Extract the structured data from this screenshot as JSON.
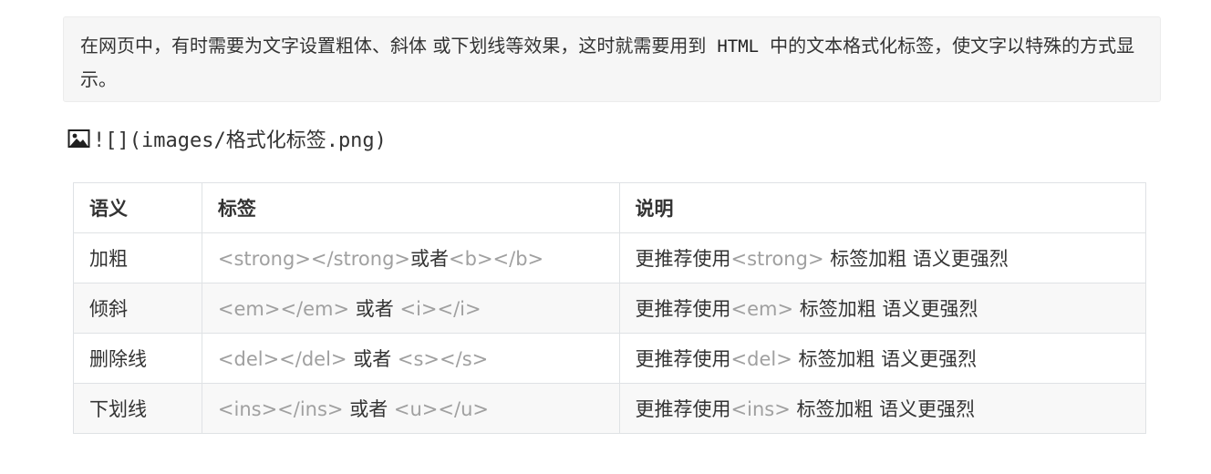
{
  "intro": {
    "text_before": "在网页中，有时需要为文字设置粗体、斜体 或下划线等效果，这时就需要用到",
    "code": "HTML",
    "text_after": "中的文本格式化标签，使文字以特殊的方式显示。"
  },
  "broken_image": {
    "icon": "image-icon",
    "markdown": "![](images/格式化标签.png)"
  },
  "table": {
    "headers": [
      "语义",
      "标签",
      "说明"
    ],
    "rows": [
      {
        "semantic": "加粗",
        "tag_a": "<strong></strong>",
        "connector": "或者",
        "tag_b": "<b></b>",
        "desc_prefix": "更推荐使用",
        "desc_tag": "<strong>",
        "desc_suffix": " 标签加粗 语义更强烈"
      },
      {
        "semantic": "倾斜",
        "tag_a": "<em></em>",
        "connector": " 或者 ",
        "tag_b": "<i></i>",
        "desc_prefix": "更推荐使用",
        "desc_tag": "<em>",
        "desc_suffix": " 标签加粗 语义更强烈"
      },
      {
        "semantic": "删除线",
        "tag_a": "<del></del>",
        "connector": " 或者 ",
        "tag_b": "<s></s>",
        "desc_prefix": "更推荐使用",
        "desc_tag": "<del>",
        "desc_suffix": " 标签加粗 语义更强烈"
      },
      {
        "semantic": "下划线",
        "tag_a": "<ins></ins>",
        "connector": " 或者 ",
        "tag_b": "<u></u>",
        "desc_prefix": "更推荐使用",
        "desc_tag": "<ins>",
        "desc_suffix": " 标签加粗 语义更强烈"
      }
    ]
  },
  "colors": {
    "tag_text": "#a0a0a0",
    "quote_background": "#f6f6f6",
    "table_border": "#dfe2e5"
  }
}
